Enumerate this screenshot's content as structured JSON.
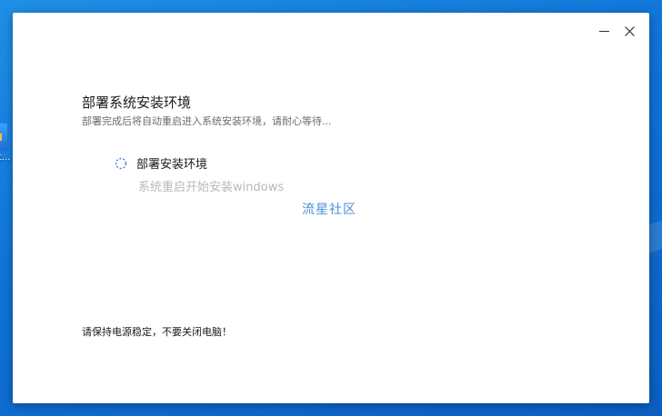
{
  "desktop": {
    "icon_label": "t..."
  },
  "window": {
    "minimize_icon": "minimize-icon",
    "close_icon": "close-icon"
  },
  "main": {
    "title": "部署系统安装环境",
    "subtitle": "部署完成后将自动重启进入系统安装环境，请耐心等待...",
    "step": {
      "title": "部署安装环境",
      "description": "系统重启开始安装windows",
      "status_icon": "loading-spinner-icon"
    },
    "watermark": "流星社区",
    "footer_note": "请保持电源稳定，不要关闭电脑！"
  },
  "colors": {
    "desktop_bg": "#1478DC",
    "watermark": "#4A90D9",
    "spinner": "#3b7fd4"
  }
}
